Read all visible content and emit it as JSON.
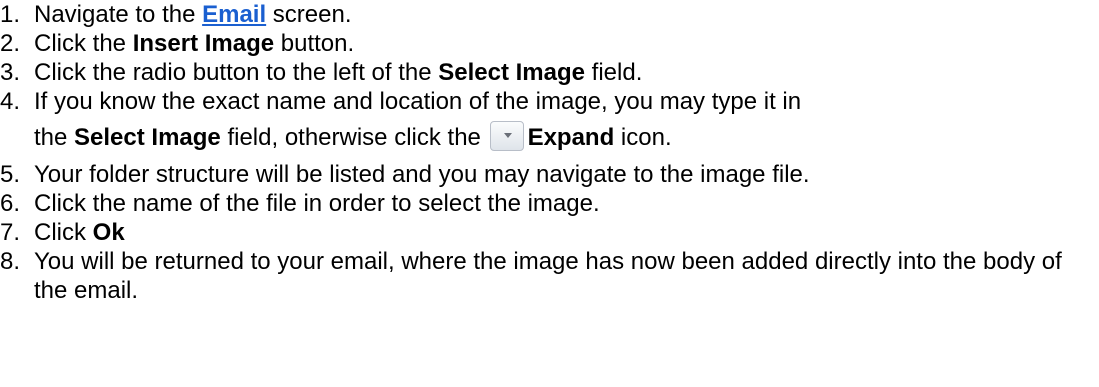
{
  "steps": [
    {
      "num": "1.",
      "pre": "Navigate to the ",
      "link": "Email",
      "post": " screen."
    },
    {
      "num": "2.",
      "pre": "Click the ",
      "bold": "Insert Image",
      "post": " button."
    },
    {
      "num": "3.",
      "pre": "Click the radio button to the left of the ",
      "bold": "Select Image",
      "post": " field."
    },
    {
      "num": "4.",
      "line1": "If you know the exact name and location of the image, you may type it in",
      "line2_pre": "the ",
      "line2_bold": "Select Image",
      "line2_mid": " field, otherwise click the ",
      "icon": "expand-icon",
      "line2_bold2": "Expand",
      "line2_post": " icon."
    },
    {
      "num": "5.",
      "text": "Your folder structure will be listed and you may navigate to the image file."
    },
    {
      "num": "6.",
      "text": "Click the name of the file in order to select the image."
    },
    {
      "num": "7.",
      "pre": "Click ",
      "bold": "Ok"
    },
    {
      "num": "8.",
      "text": "You will be returned to your email, where the image has now been added directly into the body of the email."
    }
  ],
  "colors": {
    "link": "#1a5fd0",
    "text": "#000000",
    "background": "#ffffff"
  }
}
